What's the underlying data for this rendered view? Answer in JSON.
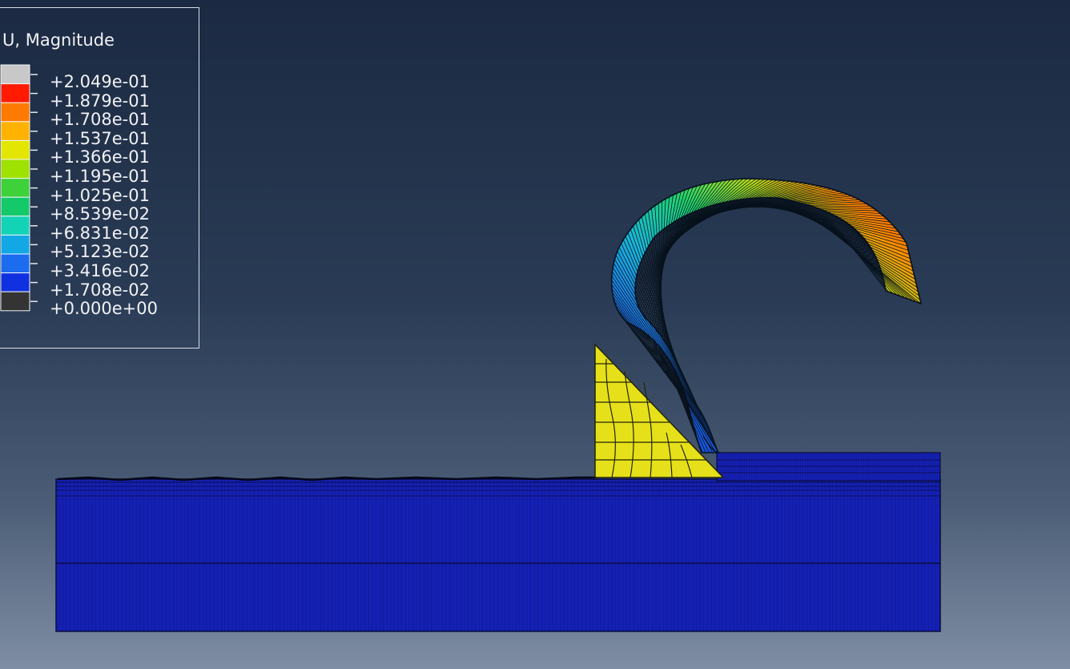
{
  "legend": {
    "title": "U, Magnitude",
    "labels": [
      "+2.049e-01",
      "+1.879e-01",
      "+1.708e-01",
      "+1.537e-01",
      "+1.366e-01",
      "+1.195e-01",
      "+1.025e-01",
      "+8.539e-02",
      "+6.831e-02",
      "+5.123e-02",
      "+3.416e-02",
      "+1.708e-02",
      "+0.000e+00"
    ],
    "colors": [
      "#c8c8c8",
      "#ff1a00",
      "#ff7a00",
      "#ffb300",
      "#e3e600",
      "#9fe100",
      "#3fd13a",
      "#14c96a",
      "#13d3b6",
      "#12a8e6",
      "#1c6cf0",
      "#1031e0",
      "#343434"
    ]
  },
  "model": {
    "workpiece_color": "#1420b4",
    "tool_color": "#e6e01a",
    "chip_colors": [
      "#0b2bc9",
      "#1f6ee8",
      "#18b7d8",
      "#1fd46d",
      "#b9e01a",
      "#ff8a00",
      "#ff2a00"
    ]
  }
}
